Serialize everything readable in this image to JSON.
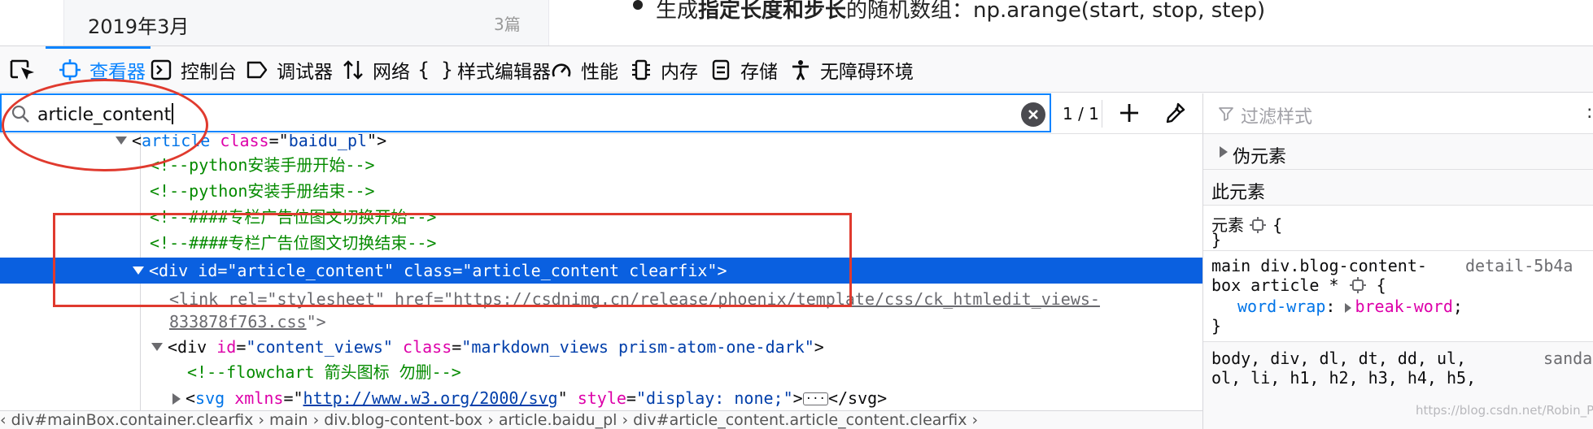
{
  "page": {
    "sidebar_month": "2019年3月",
    "sidebar_count": "3篇",
    "bullet_prefix": "生成",
    "bullet_bold": "指定长度和步长",
    "bullet_suffix": "的随机数组：np.arange(start, stop, step)"
  },
  "toolbar": {
    "tabs": [
      {
        "label": "查看器",
        "icon": "inspector-icon",
        "selected": true
      },
      {
        "label": "控制台",
        "icon": "console-icon"
      },
      {
        "label": "调试器",
        "icon": "debugger-icon"
      },
      {
        "label": "网络",
        "icon": "network-icon"
      },
      {
        "label": "样式编辑器",
        "icon": "style-editor-icon",
        "glyph": "{ }"
      },
      {
        "label": "性能",
        "icon": "performance-icon"
      },
      {
        "label": "内存",
        "icon": "memory-icon"
      },
      {
        "label": "存储",
        "icon": "storage-icon"
      },
      {
        "label": "无障碍环境",
        "icon": "accessibility-icon"
      }
    ]
  },
  "search": {
    "value": "article_content",
    "match_count": "1 / 1"
  },
  "rules_filter": {
    "placeholder": "过滤样式",
    "colon": ":"
  },
  "markup": {
    "line1": {
      "lt": "<",
      "tag": "article",
      "attr": "class",
      "eq": "=\"",
      "val": "baidu_pl",
      "end": "\">"
    },
    "line2": "<!--python安装手册开始-->",
    "line3": "<!--python安装手册结束-->",
    "line4": "<!--####专栏广告位图文切换开始-->",
    "line5": "<!--####专栏广告位图文切换结束-->",
    "line6": {
      "open": "<div ",
      "id_attr": "id",
      "id_val": "\"article_content\"",
      "class_attr": "class",
      "class_val": "\"article_content clearfix\"",
      "close": ">"
    },
    "line7": {
      "open": "<link ",
      "rel_attr": "rel",
      "rel_val": "\"stylesheet\"",
      "href_attr": "href",
      "href_val": "https://csdnimg.cn/release/phoenix/template/css/ck_htmledit_views-",
      "close": ">"
    },
    "line8": {
      "href_val": "833878f763.css",
      "close": ">"
    },
    "line9": {
      "open": "<div ",
      "id_attr": "id",
      "id_val": "\"content_views\"",
      "class_attr": "class",
      "class_val": "\"markdown_views prism-atom-one-dark\"",
      "close": ">"
    },
    "line10": "<!--flowchart 箭头图标 勿删-->",
    "line11": {
      "open": "<svg ",
      "attr1": "xmlns",
      "val1": "http://www.w3.org/2000/svg",
      "attr2": "style",
      "val2": "\"display: none;\"",
      "close": ">",
      "ellipsis": "···",
      "end": "</svg>"
    }
  },
  "breadcrumbs": "‹    div#mainBox.container.clearfix  ›  main  ›  div.blog-content-box  ›  article.baidu_pl  ›  div#article_content.article_content.clearfix  ›",
  "rules": {
    "pseudo_title": "伪元素",
    "this_element_title": "此元素",
    "element_label": "元素",
    "element_brace": "{",
    "close_brace": "}",
    "rule2_selector_a": "main div.blog-content-",
    "rule2_selector_b": "box article *",
    "rule2_source": "detail-5b4a",
    "rule2_prop": "word-wrap",
    "rule2_value": "break-word",
    "rule3_selector_a": "body, div, dl, dt, dd, ul,",
    "rule3_selector_b": "ol, li, h1, h2, h3, h4, h5,",
    "rule3_source": "sanda"
  },
  "watermark": "https://blog.csdn.net/Robin_Pi",
  "colors": {
    "accent": "#0a84ff",
    "selection": "#0a60e0",
    "annotation": "#e03a2e"
  }
}
